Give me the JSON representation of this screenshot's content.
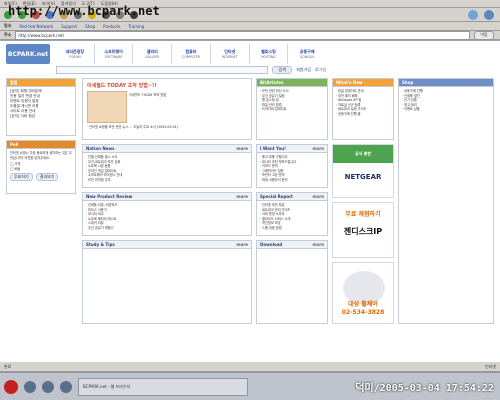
{
  "watermark": "http://www.bcpark.net",
  "browser": {
    "menu": [
      "파일(F)",
      "편집(E)",
      "보기(V)",
      "즐겨찾기",
      "도구(T)",
      "도움말(H)"
    ],
    "toolbar_labels": [
      "뒤로",
      "앞으로",
      "중지",
      "새로고침",
      "홈",
      "검색",
      "즐겨찾기",
      "기록",
      "메일",
      "인쇄"
    ],
    "links_label": "링크",
    "links": [
      "Red Hat Network",
      "Support",
      "Shop",
      "Products",
      "Training"
    ],
    "address_label": "주소",
    "address_value": "http://www.bcpark.net/",
    "go_label": "이동"
  },
  "site": {
    "logo": "BCPARK.net",
    "nav": [
      {
        "kr": "네티즌광장",
        "en": "FORUM"
      },
      {
        "kr": "소프트웨어",
        "en": "SOFTWARE"
      },
      {
        "kr": "갤러리",
        "en": "GALLERY"
      },
      {
        "kr": "컴퓨터",
        "en": "COMPUTER"
      },
      {
        "kr": "인터넷",
        "en": "INTERNET"
      },
      {
        "kr": "웹호스팅",
        "en": "HOSTING"
      },
      {
        "kr": "공동구매",
        "en": "GONGGU"
      }
    ],
    "search_placeholder": "",
    "search_button": "검색",
    "header_links": [
      "회원가입",
      "로그인"
    ],
    "left_notice_title": "알림",
    "left_notice_lines": [
      "[공지] 회원 여러분께",
      "인증 절차 변경 안내",
      "이벤트 당첨자 발표",
      "도움말 게시판 이용",
      "사이트 이용 안내",
      "[공지] 서버 점검"
    ],
    "left_poll_title": "Poll",
    "left_poll_text": "인터넷 쇼핑시 가장 중요하게 생각하는 것은 무엇입니까? 의견을 남겨주세요.",
    "left_poll_options": [
      "가격",
      "배송"
    ],
    "left_poll_buttons": [
      "투표하기",
      "결과보기"
    ],
    "featured_title": "이세월드 TODAY 조작 방법~!!",
    "featured_sub": "이세월드 TODAY 조작 방법",
    "center_news_line": "· 인터넷 쇼핑몰 보안 관련 뉴스 ... 오늘의 주요 소식 (2005.03.04)",
    "what_new_title": "What's New",
    "what_new_lines": [
      "· 한글 업데이트 안내",
      "· 보안 패치 배포",
      "· Windows XP 팁",
      "· 자료실 신규 등록",
      "· 네트워크 설정 가이드",
      "· 공동구매 진행 중"
    ],
    "mid_right_title": "BitArticles",
    "mid_right_lines": [
      "· 보안 관련 최신 소식",
      "· 무선 공유기 설정",
      "· 웹 호스팅 팁",
      "· 파일 관리 방법",
      "· 드라이버 업데이트"
    ],
    "ad_top_brand": "NETGEAR",
    "ad_top_sub": "공식 총판",
    "ad_mid_text1": "무료 체험하기",
    "ad_mid_text2": "젠디스크IP",
    "ad_bottom_text1": "대성 휠체어",
    "ad_bottom_text2": "02-534-3828",
    "sections": [
      {
        "title": "Nation News",
        "more": "more"
      },
      {
        "title": "I Want You!",
        "more": "more"
      },
      {
        "title": "New Product Review",
        "more": "more"
      },
      {
        "title": "Special Report",
        "more": "more"
      },
      {
        "title": "Study & Tips",
        "more": "more"
      },
      {
        "title": "Download",
        "more": "more"
      }
    ],
    "section_lines": [
      [
        "· 인텔 신제품 출시 소식",
        "· 무선 네트워크 보안 강화",
        "· 노트북 시장 동향",
        "· 온라인 게임 업데이트",
        "· 소프트웨어 라이센스 안내",
        "· 보안 취약점 주의"
      ],
      [
        "· 중고 부품 구합니다",
        "· 모니터 추천 부탁드립니다",
        "· 키보드 문의",
        "· 그래픽카드 질문",
        "· 프린터 고장 문의",
        "· 파워 서플라이 문의"
      ],
      [
        "· 신제품 리뷰: 외장하드",
        "· 마우스 사용기",
        "· 모니터 비교",
        "· 노트북 배터리 테스트",
        "· 스피커 리뷰",
        "· 무선 공유기 체험기"
      ],
      [
        "· 인터넷 보안 특집",
        "· 네트워크 관리 가이드",
        "· 서버 운영 노하우",
        "· 클라우드 서비스 소개",
        "· 개인정보 보호",
        "· 스팸 대응 방법"
      ]
    ],
    "right_small_title": "Shop",
    "right_small_lines": [
      "· 공동구매 진행",
      "· 신제품 할인",
      "· 인기 상품",
      "· 재고 정리",
      "· 이벤트 상품"
    ]
  },
  "status": {
    "left": "완료",
    "right": "인터넷",
    "timestamp": "덕미/2005-03-04 17:54:22"
  },
  "taskbar": {
    "items": [
      "BCPARK.net - 웹 브라우저"
    ]
  }
}
